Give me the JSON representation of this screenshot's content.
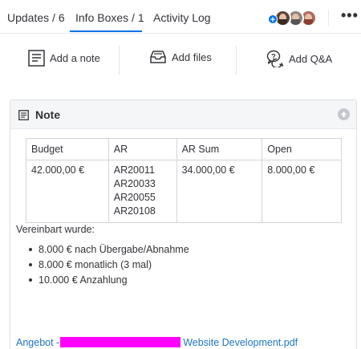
{
  "tabs": {
    "items": [
      {
        "label": "Updates / 6"
      },
      {
        "label": "Info Boxes / 1"
      },
      {
        "label": "Activity Log"
      }
    ],
    "active_index": 1,
    "more_label": "•••",
    "add_subscriber_label": "+"
  },
  "actions": {
    "add_note": "Add a note",
    "add_files": "Add files",
    "add_qa": "Add Q&A"
  },
  "note": {
    "title": "Note",
    "table": {
      "headers": [
        "Budget",
        "AR",
        "AR Sum",
        "Open"
      ],
      "rows": [
        [
          "42.000,00 €",
          "AR20011\nAR20033\nAR20055\nAR20108",
          "34.000,00 €",
          "8.000,00 €"
        ]
      ]
    },
    "agreed_label": "Vereinbart wurde:",
    "terms": [
      "8.000 € nach Übergabe/Abnahme",
      "8.000 € monatlich (3 mal)",
      "10.000 € Anzahlung"
    ],
    "attachment": {
      "prefix": "Angebot -",
      "suffix": "Website Development.pdf"
    }
  },
  "colors": {
    "accent": "#0073ea",
    "link": "#1f76c2",
    "redaction": "#ff00ff"
  }
}
